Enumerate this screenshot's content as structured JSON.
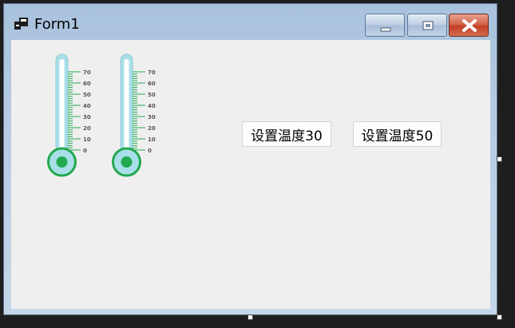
{
  "window": {
    "title": "Form1",
    "icon": "form-window-icon",
    "controls": {
      "minimize": "minimize-icon",
      "maximize": "maximize-icon",
      "close": "close-icon"
    }
  },
  "thermometers": [
    {
      "scale_labels": [
        "70",
        "60",
        "50",
        "40",
        "30",
        "20",
        "10",
        "0"
      ],
      "fill_color": "#21a94f",
      "tube_color": "#a9dfe9"
    },
    {
      "scale_labels": [
        "70",
        "60",
        "50",
        "40",
        "30",
        "20",
        "10",
        "0"
      ],
      "fill_color": "#21a94f",
      "tube_color": "#a9dfe9"
    }
  ],
  "buttons": {
    "set_temp_30": "设置温度30",
    "set_temp_50": "设置温度50"
  },
  "colors": {
    "accent_green": "#21a94f",
    "client_bg": "#f0efef",
    "close_red": "#c44025"
  }
}
